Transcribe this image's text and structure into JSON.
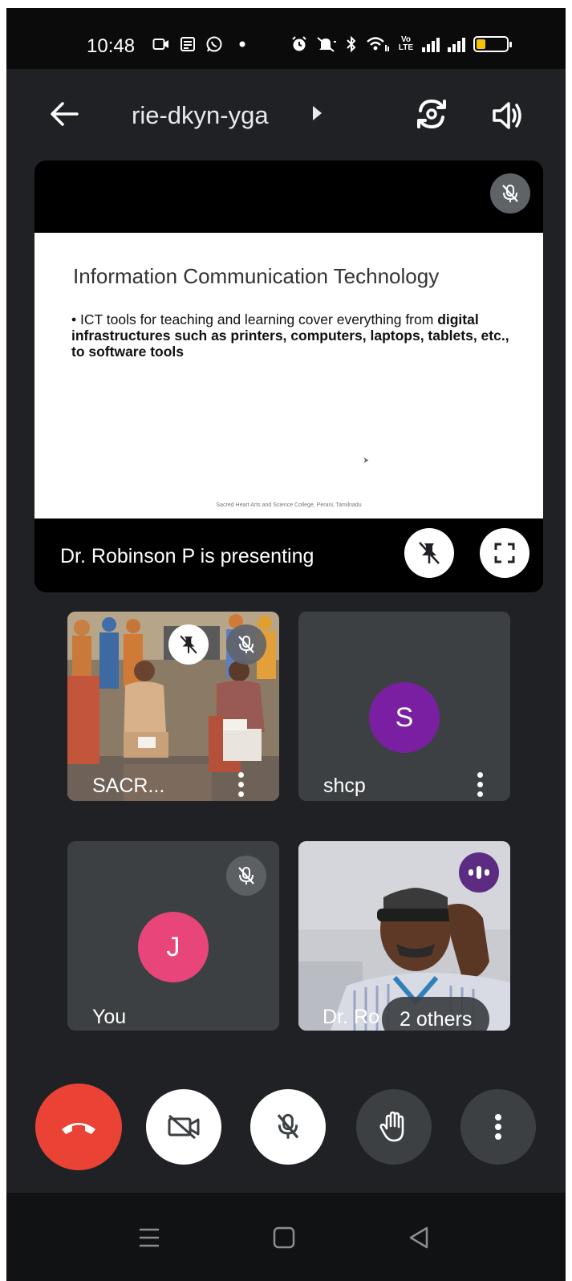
{
  "status_bar": {
    "time": "10:48",
    "volte_label": "Vo\nLTE",
    "battery_level": 0.3,
    "battery_color": "#f6c300"
  },
  "top_bar": {
    "meeting_code": "rie-dkyn-yga",
    "icons": [
      "back-arrow-icon",
      "switch-camera-icon",
      "speaker-icon"
    ]
  },
  "presentation": {
    "slide_title": "Information Communication Technology",
    "bullet_prefix": "ICT tools for teaching and learning cover everything from ",
    "bullet_bold": "digital infrastructures such as printers, computers, laptops, tablets, etc., to software tools",
    "slide_footer": "Sacred Heart Arts and Science College, Perani, Tamilnadu",
    "presenting_text": "Dr. Robinson P is presenting"
  },
  "participants": [
    {
      "name": "SACR...",
      "type": "video",
      "muted": true,
      "pinned": true
    },
    {
      "name": "shcp",
      "type": "avatar",
      "initial": "S",
      "avatar_color": "#7b1fa2"
    },
    {
      "name": "You",
      "type": "avatar",
      "initial": "J",
      "avatar_color": "#e8457a",
      "muted": true
    },
    {
      "name": "Dr. Robinson P",
      "name_visible": "Dr. Ro",
      "type": "video",
      "speaking": true,
      "others_label": "2 others"
    }
  ],
  "controls": {
    "end_call_color": "#ea4335",
    "buttons": [
      "end-call-button",
      "camera-off-button",
      "mic-off-button",
      "raise-hand-button",
      "more-options-button"
    ]
  },
  "colors": {
    "background": "#202124",
    "tile": "#3c4043",
    "speaking_badge": "#5c2c82"
  }
}
